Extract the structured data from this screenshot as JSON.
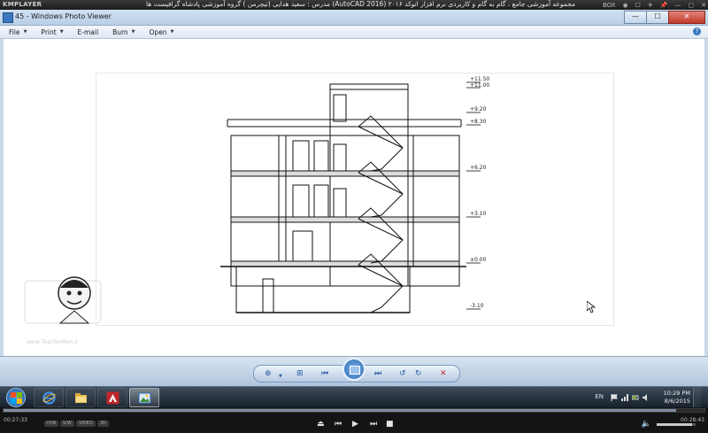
{
  "kmplayer": {
    "logo": "KMPLAYER",
    "caption": "مجموعه آموزشی جامع ، گام به گام و کاربردی نرم افزار  اتوکد ۲۰۱۶ (AutoCAD 2016)  مدرس : سعید هدایی (تیچرمن ) گروه آموزشی پادشاه گرافیست ها",
    "controls": [
      "BOX",
      "◉",
      "☐",
      "✈",
      "📌",
      "—",
      "▢",
      "✕"
    ],
    "time_elapsed": "00:27:33",
    "time_total": "00:28:43",
    "progress": 0.96,
    "volume": 0.9,
    "chips": [
      "H/W",
      "S/W",
      "VIDEO",
      "3D"
    ]
  },
  "viewer": {
    "title": "45 - Windows Photo Viewer",
    "menu": [
      {
        "label": "File"
      },
      {
        "label": "Print"
      },
      {
        "label": "E-mail"
      },
      {
        "label": "Burn"
      },
      {
        "label": "Open"
      }
    ],
    "window_buttons": [
      "—",
      "☐",
      "✕"
    ],
    "help": "?"
  },
  "drawing": {
    "levels": [
      "+11.50",
      "+11.00",
      "+9.20",
      "+8.30",
      "+6.20",
      "+3.10",
      "±0.00",
      "-3.10"
    ]
  },
  "watermark": {
    "url": "www.TeacherMan.ir"
  },
  "taskbar": {
    "apps": [
      "windows-explorer",
      "internet-explorer",
      "file-explorer",
      "autocad",
      "photo-viewer"
    ],
    "language": "EN",
    "time": "10:29 PM",
    "date": "8/6/2015"
  },
  "colors": {
    "viewer_titlebar": "#b9cfe6",
    "taskbar": "#16202b",
    "autocad_red": "#c0262c",
    "ie_blue": "#2b79d1"
  }
}
